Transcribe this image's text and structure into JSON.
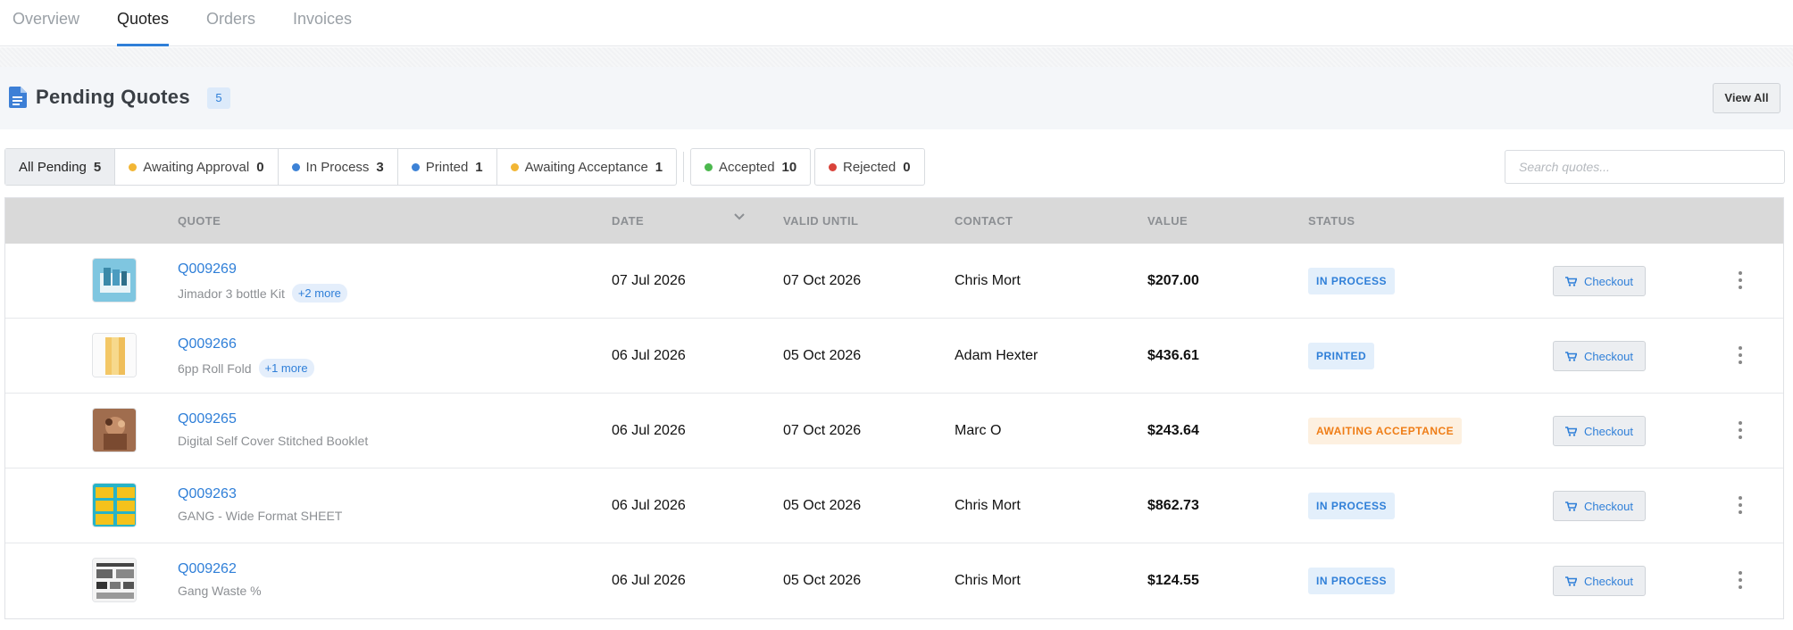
{
  "tabs": [
    {
      "label": "Overview"
    },
    {
      "label": "Quotes"
    },
    {
      "label": "Orders"
    },
    {
      "label": "Invoices"
    }
  ],
  "panel": {
    "icon": "document-icon",
    "title": "Pending Quotes",
    "count": "5",
    "view_all": "View All"
  },
  "filters": [
    {
      "label": "All Pending",
      "count": "5",
      "dot": null
    },
    {
      "label": "Awaiting Approval",
      "count": "0",
      "dot": "#f2b635"
    },
    {
      "label": "In Process",
      "count": "3",
      "dot": "#3d82d6"
    },
    {
      "label": "Printed",
      "count": "1",
      "dot": "#3d82d6"
    },
    {
      "label": "Awaiting Acceptance",
      "count": "1",
      "dot": "#f2b635"
    },
    {
      "label": "Accepted",
      "count": "10",
      "dot": "#4cb84e"
    },
    {
      "label": "Rejected",
      "count": "0",
      "dot": "#d9433a"
    }
  ],
  "search": {
    "placeholder": "Search quotes..."
  },
  "table": {
    "headers": {
      "quote": "QUOTE",
      "date": "DATE",
      "valid_until": "VALID UNTIL",
      "contact": "CONTACT",
      "value": "VALUE",
      "status": "STATUS"
    },
    "checkout_label": "Checkout",
    "rows": [
      {
        "id": "Q009269",
        "desc": "Jimador 3 bottle Kit",
        "more": "+2 more",
        "date": "07 Jul 2026",
        "valid": "07 Oct 2026",
        "contact": "Chris Mort",
        "value": "$207.00",
        "status": "IN PROCESS",
        "status_bg": "#e3effb",
        "status_fg": "#2f7fd8"
      },
      {
        "id": "Q009266",
        "desc": "6pp Roll Fold",
        "more": "+1 more",
        "date": "06 Jul 2026",
        "valid": "05 Oct 2026",
        "contact": "Adam Hexter",
        "value": "$436.61",
        "status": "PRINTED",
        "status_bg": "#e3effb",
        "status_fg": "#2f7fd8"
      },
      {
        "id": "Q009265",
        "desc": "Digital Self Cover Stitched Booklet",
        "more": null,
        "date": "06 Jul 2026",
        "valid": "07 Oct 2026",
        "contact": "Marc O",
        "value": "$243.64",
        "status": "AWAITING ACCEPTANCE",
        "status_bg": "#fdf0e0",
        "status_fg": "#ef7d16"
      },
      {
        "id": "Q009263",
        "desc": "GANG - Wide Format SHEET",
        "more": null,
        "date": "06 Jul 2026",
        "valid": "05 Oct 2026",
        "contact": "Chris Mort",
        "value": "$862.73",
        "status": "IN PROCESS",
        "status_bg": "#e3effb",
        "status_fg": "#2f7fd8"
      },
      {
        "id": "Q009262",
        "desc": "Gang Waste %",
        "more": null,
        "date": "06 Jul 2026",
        "valid": "05 Oct 2026",
        "contact": "Chris Mort",
        "value": "$124.55",
        "status": "IN PROCESS",
        "status_bg": "#e3effb",
        "status_fg": "#2f7fd8"
      }
    ]
  }
}
